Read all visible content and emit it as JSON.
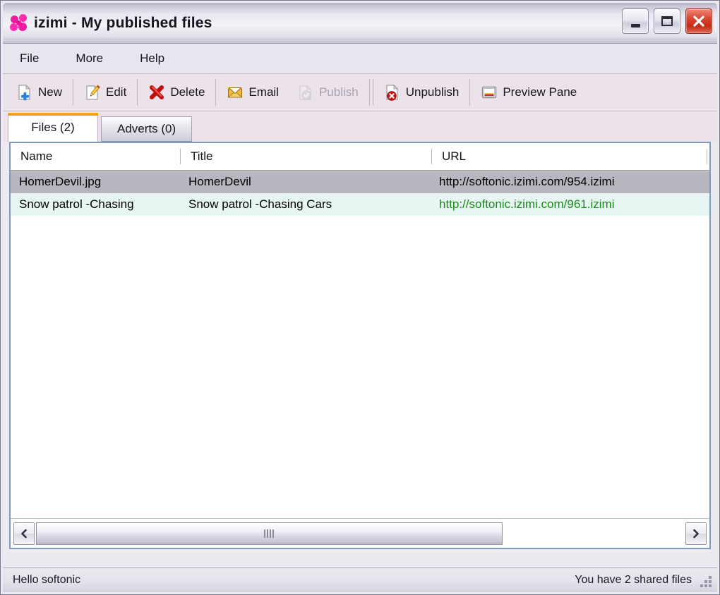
{
  "window": {
    "title": "izimi - My published files",
    "app_icon": "izimi-flower-icon",
    "accent_color": "#ef1ba0",
    "buttons": {
      "minimize": "minimize-button",
      "maximize": "maximize-button",
      "close": "close-button"
    }
  },
  "menu": {
    "items": [
      {
        "label": "File"
      },
      {
        "label": "More"
      },
      {
        "label": "Help"
      }
    ]
  },
  "toolbar": {
    "buttons": [
      {
        "label": "New",
        "icon": "new-document-icon",
        "enabled": true,
        "sep_after": true
      },
      {
        "label": "Edit",
        "icon": "edit-pencil-icon",
        "enabled": true,
        "sep_after": true
      },
      {
        "label": "Delete",
        "icon": "delete-x-icon",
        "enabled": true,
        "sep_after": true
      },
      {
        "label": "Email",
        "icon": "email-envelope-icon",
        "enabled": true,
        "sep_after": false
      },
      {
        "label": "Publish",
        "icon": "publish-check-icon",
        "enabled": false,
        "sep_after": true
      },
      {
        "label": "Unpublish",
        "icon": "unpublish-stop-icon",
        "enabled": true,
        "sep_after": true
      },
      {
        "label": "Preview Pane",
        "icon": "preview-pane-icon",
        "enabled": true,
        "sep_after": false
      }
    ]
  },
  "tabs": {
    "active_index": 0,
    "items": [
      {
        "label": "Files (2)"
      },
      {
        "label": "Adverts (0)"
      }
    ]
  },
  "file_list": {
    "columns": [
      "Name",
      "Title",
      "URL"
    ],
    "rows": [
      {
        "name": "HomerDevil.jpg",
        "title": "HomerDevil",
        "url": "http://softonic.izimi.com/954.izimi",
        "selected": true,
        "url_published": false
      },
      {
        "name": "Snow patrol -Chasing",
        "title": "Snow patrol -Chasing Cars",
        "url": "http://softonic.izimi.com/961.izimi",
        "selected": false,
        "url_published": true
      }
    ],
    "published_url_color": "#1a8a1a"
  },
  "scrollbar": {
    "left_arrow": "scroll-left-arrow",
    "right_arrow": "scroll-right-arrow",
    "thumb": "horizontal-scroll-thumb"
  },
  "statusbar": {
    "left_text": "Hello softonic",
    "right_text": "You have 2 shared files"
  }
}
